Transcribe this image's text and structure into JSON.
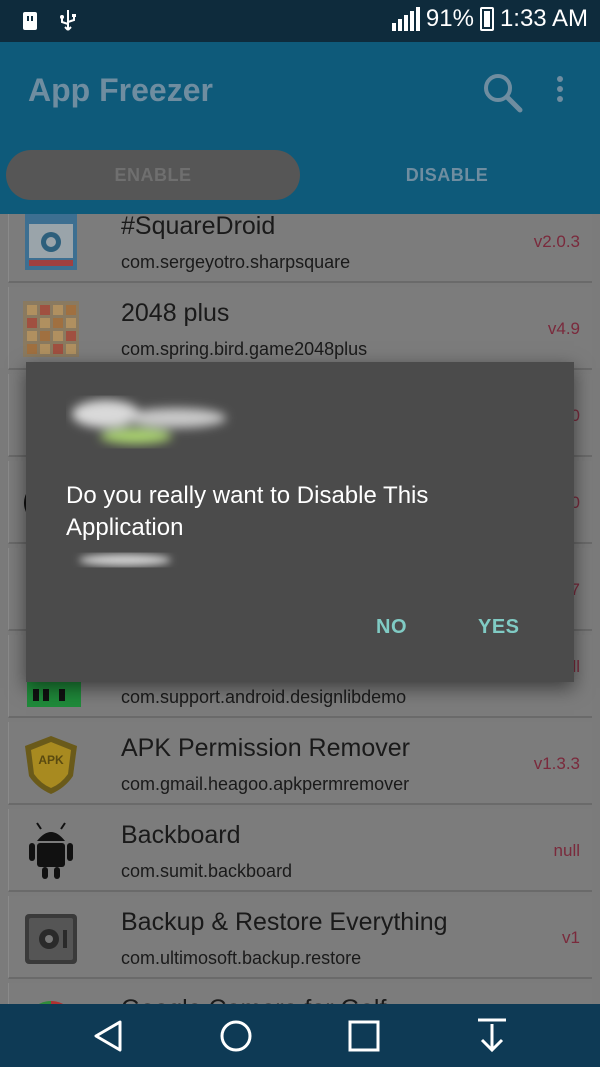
{
  "status_bar": {
    "battery_percent": "91%",
    "time": "1:33 AM",
    "left_icons": [
      "usb-icon",
      "usb-debug-icon"
    ]
  },
  "app_bar": {
    "title": "App Freezer",
    "icons": [
      "search-icon",
      "more-vert-icon"
    ]
  },
  "tabs": [
    {
      "label": "ENABLE",
      "selected": true
    },
    {
      "label": "DISABLE",
      "selected": false
    }
  ],
  "apps": [
    {
      "name": "#SquareDroid",
      "package": "com.sergeyotro.sharpsquare",
      "version": "v2.0.3",
      "icon": "camera-app-icon"
    },
    {
      "name": "2048 plus",
      "package": "com.spring.bird.game2048plus",
      "version": "v4.9",
      "icon": "grid-game-icon"
    },
    {
      "name": "",
      "package": "",
      "version": "0",
      "icon": "blue-triangle-icon"
    },
    {
      "name": "",
      "package": "",
      "version": "0",
      "icon": "dark-round-icon"
    },
    {
      "name": "",
      "package": "",
      "version": "7",
      "icon": "orange-square-icon"
    },
    {
      "name": "",
      "package": "com.support.android.designlibdemo",
      "version": "null",
      "icon": "green-android-icon"
    },
    {
      "name": "APK Permission Remover",
      "package": "com.gmail.heagoo.apkpermremover",
      "version": "v1.3.3",
      "icon": "shield-apk-icon"
    },
    {
      "name": "Backboard",
      "package": "com.sumit.backboard",
      "version": "null",
      "icon": "android-robot-icon"
    },
    {
      "name": "Backup & Restore Everything",
      "package": "com.ultimosoft.backup.restore",
      "version": "v1",
      "icon": "safe-icon"
    },
    {
      "name": "Google Camera for Galf",
      "package": "",
      "version": "",
      "icon": "colorful-circle-icon"
    }
  ],
  "dialog": {
    "message": "Do you really want to Disable This Application",
    "no_label": "NO",
    "yes_label": "YES"
  },
  "nav_bar": {
    "icons": [
      "back-icon",
      "home-icon",
      "recents-icon",
      "notification-pulldown-icon"
    ]
  },
  "colors": {
    "status_bar_bg": "#0e2b3c",
    "app_bar_bg": "#0e5a7a",
    "dialog_bg": "#4b4b4b",
    "dialog_button": "#80cbc4",
    "version_text": "#7a2a3c",
    "nav_bar_bg": "#0e3a55"
  }
}
